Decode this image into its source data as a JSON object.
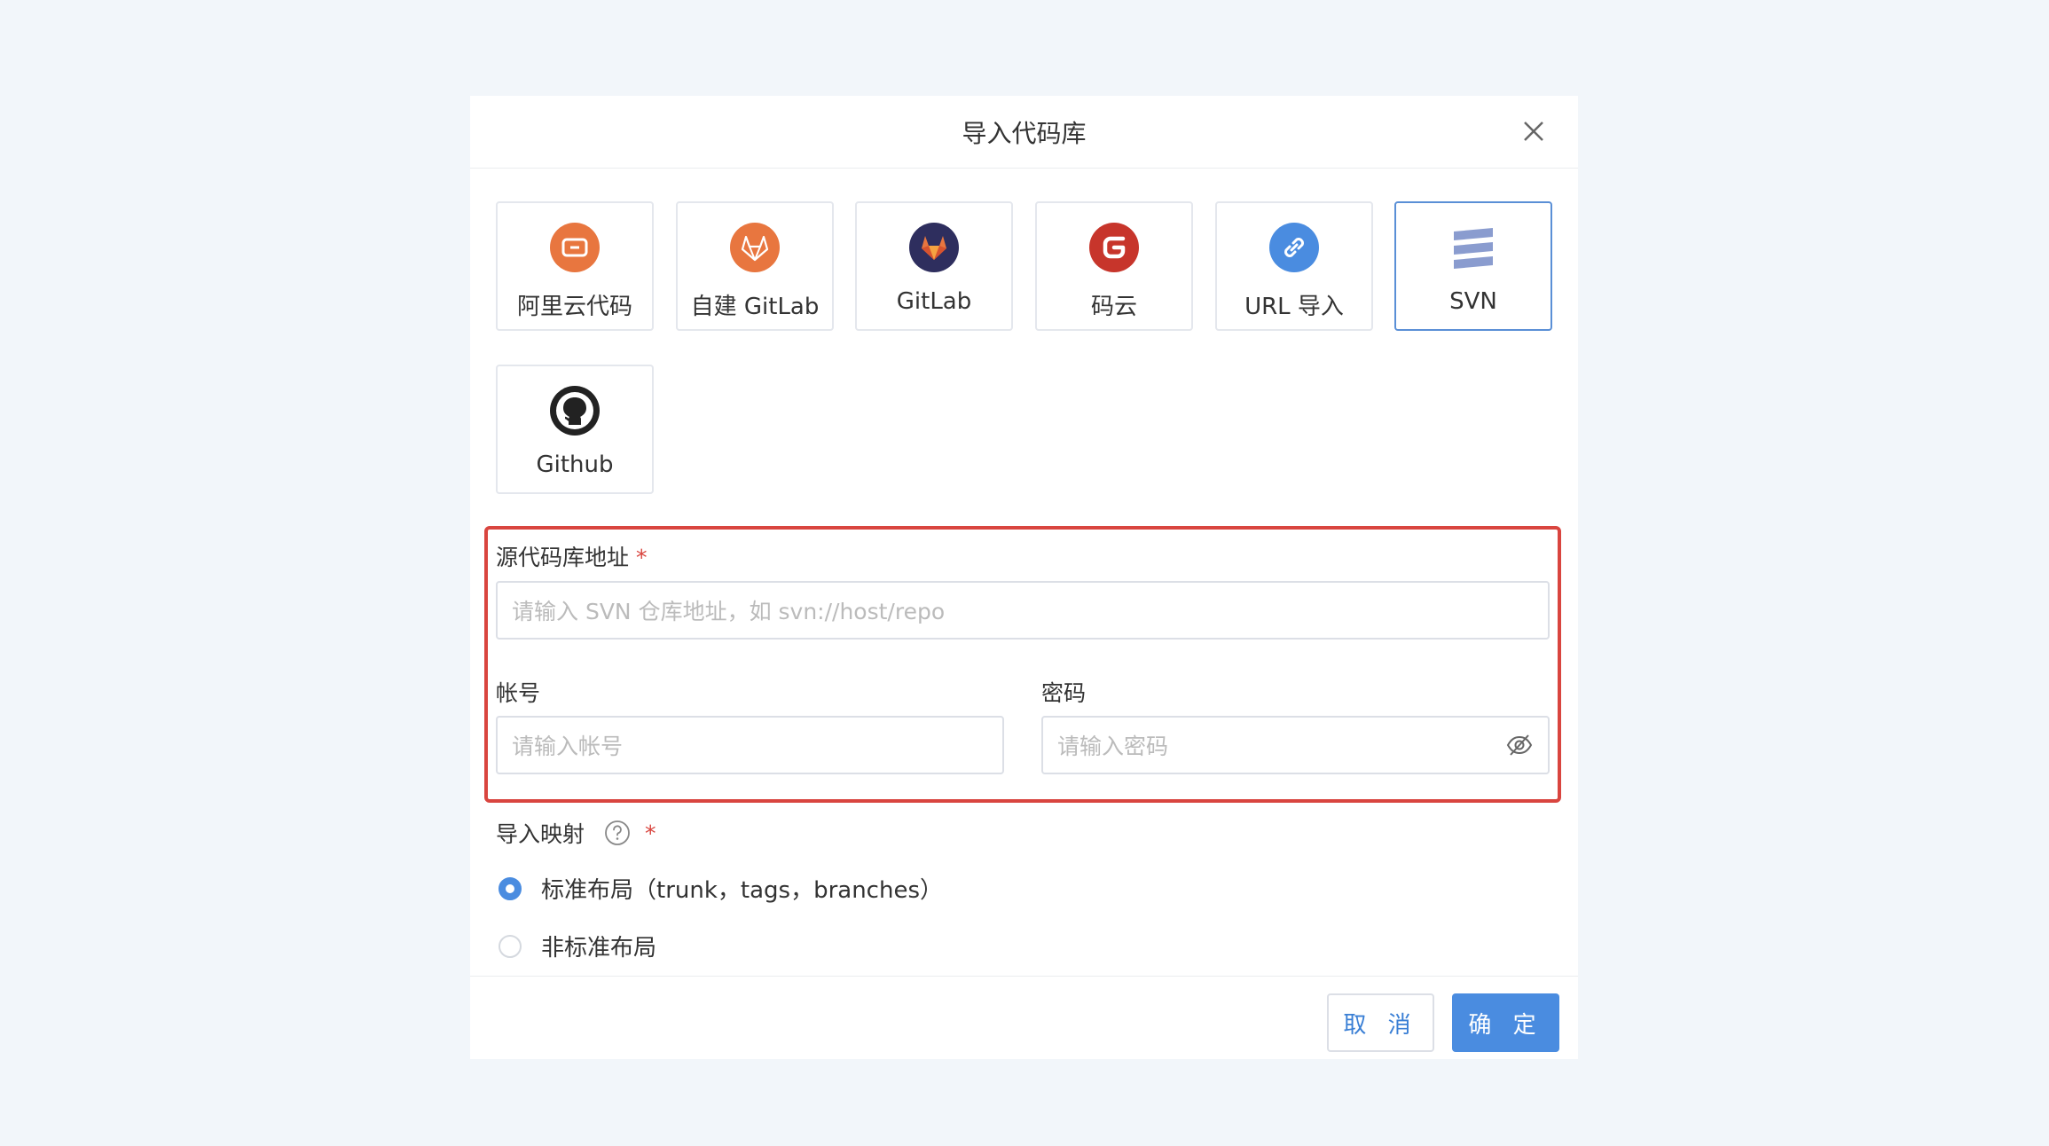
{
  "dialog": {
    "title": "导入代码库"
  },
  "sources": [
    {
      "label": "阿里云代码",
      "icon": "aliyun-code-icon",
      "selected": false
    },
    {
      "label": "自建 GitLab",
      "icon": "self-hosted-gitlab-icon",
      "selected": false
    },
    {
      "label": "GitLab",
      "icon": "gitlab-icon",
      "selected": false
    },
    {
      "label": "码云",
      "icon": "gitee-icon",
      "selected": false
    },
    {
      "label": "URL 导入",
      "icon": "link-icon",
      "selected": false
    },
    {
      "label": "SVN",
      "icon": "svn-icon",
      "selected": true
    },
    {
      "label": "Github",
      "icon": "github-icon",
      "selected": false
    }
  ],
  "form": {
    "repo_url": {
      "label": "源代码库地址",
      "required_mark": "*",
      "placeholder": "请输入 SVN 仓库地址，如 svn://host/repo",
      "value": ""
    },
    "account": {
      "label": "帐号",
      "placeholder": "请输入帐号",
      "value": ""
    },
    "password": {
      "label": "密码",
      "placeholder": "请输入密码",
      "value": ""
    },
    "mapping": {
      "label": "导入映射",
      "required_mark": "*",
      "options": [
        {
          "label": "标准布局（trunk，tags，branches）",
          "checked": true
        },
        {
          "label": "非标准布局",
          "checked": false
        }
      ]
    }
  },
  "footer": {
    "cancel_label": "取 消",
    "ok_label": "确 定"
  },
  "colors": {
    "primary": "#4a8ce0",
    "highlight_border": "#d9453f",
    "aliyun": "#e8763f",
    "gitlab_self": "#e8763f",
    "gitlab_bg": "#2e2e5e",
    "gitee": "#c7352b",
    "url": "#4a8ce0",
    "svn": "#8a9ccf"
  }
}
